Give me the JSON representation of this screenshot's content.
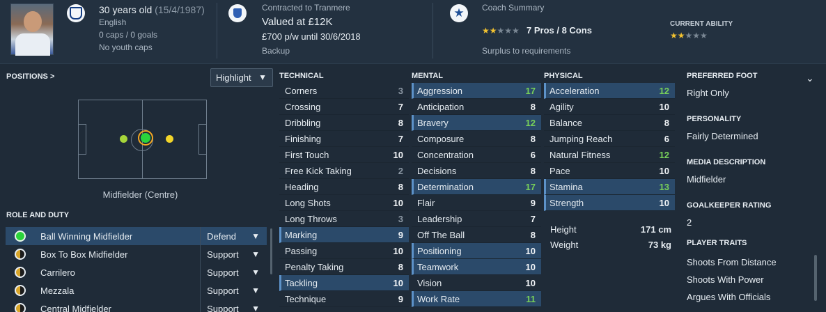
{
  "header": {
    "age": "30 years old",
    "dob": "(15/4/1987)",
    "nationality": "English",
    "caps": "0 caps / 0 goals",
    "youth_caps": "No youth caps",
    "contract": "Contracted to Tranmere",
    "value": "Valued at £12K",
    "wage": "£700 p/w until 30/6/2018",
    "squad_status": "Backup",
    "coach_summary_label": "Coach Summary",
    "coach_stars": 2,
    "pros_cons": "7 Pros / 8 Cons",
    "coach_note": "Surplus to requirements",
    "current_ability_label": "CURRENT ABILITY",
    "current_ability_stars": 2
  },
  "positions": {
    "label": "POSITIONS >",
    "highlight_label": "Highlight",
    "caption": "Midfielder (Centre)"
  },
  "roles": {
    "label": "ROLE AND DUTY",
    "items": [
      {
        "name": "Ball Winning Midfielder",
        "duty": "Defend",
        "selected": true
      },
      {
        "name": "Box To Box Midfielder",
        "duty": "Support",
        "selected": false
      },
      {
        "name": "Carrilero",
        "duty": "Support",
        "selected": false
      },
      {
        "name": "Mezzala",
        "duty": "Support",
        "selected": false
      },
      {
        "name": "Central Midfielder",
        "duty": "Support",
        "selected": false
      }
    ]
  },
  "technical": {
    "title": "TECHNICAL",
    "rows": [
      {
        "name": "Corners",
        "value": "3",
        "hl": false,
        "tone": "gr"
      },
      {
        "name": "Crossing",
        "value": "7",
        "hl": false,
        "tone": "w"
      },
      {
        "name": "Dribbling",
        "value": "8",
        "hl": false,
        "tone": "w"
      },
      {
        "name": "Finishing",
        "value": "7",
        "hl": false,
        "tone": "w"
      },
      {
        "name": "First Touch",
        "value": "10",
        "hl": false,
        "tone": "w"
      },
      {
        "name": "Free Kick Taking",
        "value": "2",
        "hl": false,
        "tone": "gr"
      },
      {
        "name": "Heading",
        "value": "8",
        "hl": false,
        "tone": "w"
      },
      {
        "name": "Long Shots",
        "value": "10",
        "hl": false,
        "tone": "w"
      },
      {
        "name": "Long Throws",
        "value": "3",
        "hl": false,
        "tone": "gr"
      },
      {
        "name": "Marking",
        "value": "9",
        "hl": true,
        "tone": "w"
      },
      {
        "name": "Passing",
        "value": "10",
        "hl": false,
        "tone": "w"
      },
      {
        "name": "Penalty Taking",
        "value": "8",
        "hl": false,
        "tone": "w"
      },
      {
        "name": "Tackling",
        "value": "10",
        "hl": true,
        "tone": "w"
      },
      {
        "name": "Technique",
        "value": "9",
        "hl": false,
        "tone": "w"
      }
    ]
  },
  "mental": {
    "title": "MENTAL",
    "rows": [
      {
        "name": "Aggression",
        "value": "17",
        "hl": true,
        "tone": "g"
      },
      {
        "name": "Anticipation",
        "value": "8",
        "hl": false,
        "tone": "w"
      },
      {
        "name": "Bravery",
        "value": "12",
        "hl": true,
        "tone": "g"
      },
      {
        "name": "Composure",
        "value": "8",
        "hl": false,
        "tone": "w"
      },
      {
        "name": "Concentration",
        "value": "6",
        "hl": false,
        "tone": "w"
      },
      {
        "name": "Decisions",
        "value": "8",
        "hl": false,
        "tone": "w"
      },
      {
        "name": "Determination",
        "value": "17",
        "hl": true,
        "tone": "g"
      },
      {
        "name": "Flair",
        "value": "9",
        "hl": false,
        "tone": "w"
      },
      {
        "name": "Leadership",
        "value": "7",
        "hl": false,
        "tone": "w"
      },
      {
        "name": "Off The Ball",
        "value": "8",
        "hl": false,
        "tone": "w"
      },
      {
        "name": "Positioning",
        "value": "10",
        "hl": true,
        "tone": "w"
      },
      {
        "name": "Teamwork",
        "value": "10",
        "hl": true,
        "tone": "w"
      },
      {
        "name": "Vision",
        "value": "10",
        "hl": false,
        "tone": "w"
      },
      {
        "name": "Work Rate",
        "value": "11",
        "hl": true,
        "tone": "g"
      }
    ]
  },
  "physical": {
    "title": "PHYSICAL",
    "rows": [
      {
        "name": "Acceleration",
        "value": "12",
        "hl": true,
        "tone": "g"
      },
      {
        "name": "Agility",
        "value": "10",
        "hl": false,
        "tone": "w"
      },
      {
        "name": "Balance",
        "value": "8",
        "hl": false,
        "tone": "w"
      },
      {
        "name": "Jumping Reach",
        "value": "6",
        "hl": false,
        "tone": "w"
      },
      {
        "name": "Natural Fitness",
        "value": "12",
        "hl": false,
        "tone": "g"
      },
      {
        "name": "Pace",
        "value": "10",
        "hl": false,
        "tone": "w"
      },
      {
        "name": "Stamina",
        "value": "13",
        "hl": true,
        "tone": "g"
      },
      {
        "name": "Strength",
        "value": "10",
        "hl": true,
        "tone": "w"
      }
    ],
    "height_label": "Height",
    "height": "171 cm",
    "weight_label": "Weight",
    "weight": "73 kg"
  },
  "details": {
    "preferred_foot_label": "PREFERRED FOOT",
    "preferred_foot": "Right Only",
    "personality_label": "PERSONALITY",
    "personality": "Fairly Determined",
    "media_label": "MEDIA DESCRIPTION",
    "media": "Midfielder",
    "gk_label": "GOALKEEPER RATING",
    "gk": "2",
    "traits_label": "PLAYER TRAITS",
    "traits": [
      "Shoots From Distance",
      "Shoots With Power",
      "Argues With Officials"
    ]
  },
  "colors": {
    "accent": "#2b4a6a",
    "good": "#78d05a",
    "star": "#f2c230"
  }
}
